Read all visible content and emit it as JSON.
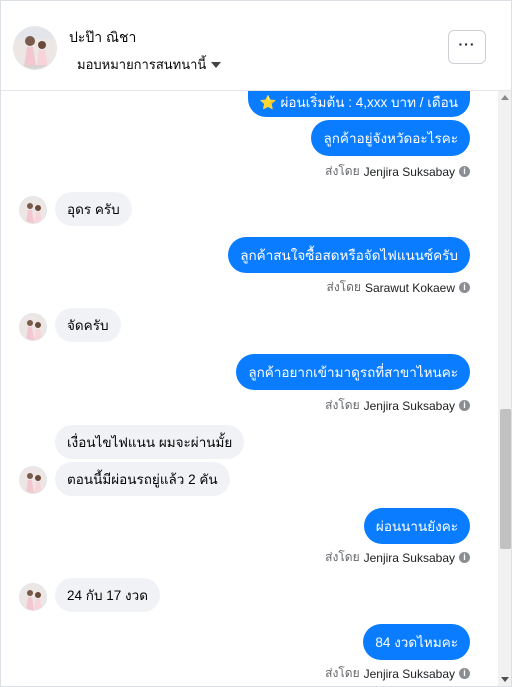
{
  "header": {
    "name": "ปะป๊า ณิชา",
    "assign_label": "มอบหมายการสนทนานี้",
    "more_label": "···"
  },
  "messages": [
    {
      "kind": "out",
      "text": "⭐ ผ่อนเริ่มต้น : 4,xxx บาท / เดือน"
    },
    {
      "kind": "out",
      "text": "ลูกค้าอยู่จังหวัดอะไรคะ"
    },
    {
      "kind": "sent_by",
      "prefix": "ส่งโดย",
      "agent": "Jenjira Suksabay"
    },
    {
      "kind": "in",
      "text": "อุดร ครับ"
    },
    {
      "kind": "out",
      "text": "ลูกค้าสนใจซื้อสดหรือจัดไฟแนนซ์ครับ"
    },
    {
      "kind": "sent_by",
      "prefix": "ส่งโดย",
      "agent": "Sarawut Kokaew"
    },
    {
      "kind": "in",
      "text": "จัดครับ"
    },
    {
      "kind": "out",
      "text": "ลูกค้าอยากเข้ามาดูรถที่สาขาไหนคะ"
    },
    {
      "kind": "sent_by",
      "prefix": "ส่งโดย",
      "agent": "Jenjira Suksabay"
    },
    {
      "kind": "in",
      "text": "เงื่อนไขไฟแนน ผมจะผ่านมั้ย"
    },
    {
      "kind": "in",
      "text": "ตอนนี้มีผ่อนรถยู่แล้ว 2 คัน"
    },
    {
      "kind": "out",
      "text": "ผ่อนนานยังคะ"
    },
    {
      "kind": "sent_by",
      "prefix": "ส่งโดย",
      "agent": "Jenjira Suksabay"
    },
    {
      "kind": "in",
      "text": "24 กับ 17 งวด"
    },
    {
      "kind": "out",
      "text": "84 งวดไหมคะ"
    },
    {
      "kind": "sent_by",
      "prefix": "ส่งโดย",
      "agent": "Jenjira Suksabay"
    }
  ],
  "icons": {
    "info": "i",
    "caret": "caret-down-icon"
  },
  "colors": {
    "outgoing_bubble": "#0a7cff",
    "incoming_bubble": "#f0f2f5",
    "sent_by_text": "#65676b"
  }
}
